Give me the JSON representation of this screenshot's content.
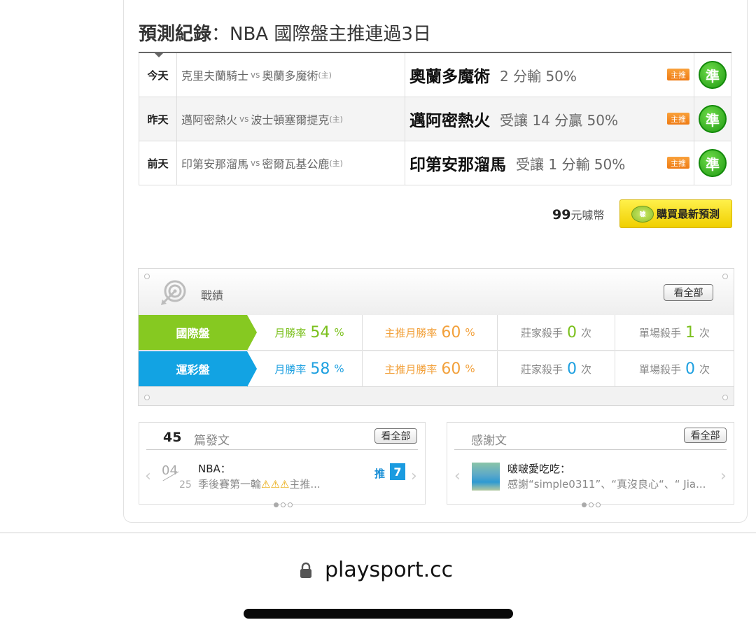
{
  "page_title": {
    "bold": "預測紀錄",
    "rest": "：NBA 國際盤主推連過3日"
  },
  "predictions": [
    {
      "day": "今天",
      "away": "克里夫蘭騎士",
      "vs": "vs",
      "home": "奧蘭多魔術",
      "home_mark": "(主)",
      "pick_team": "奧蘭多魔術",
      "pick_detail": "2 分輸 50%",
      "badge": "主推",
      "result": "準"
    },
    {
      "day": "昨天",
      "away": "邁阿密熱火",
      "vs": "vs",
      "home": "波士頓塞爾提克",
      "home_mark": "(主)",
      "pick_team": "邁阿密熱火",
      "pick_detail": "受讓 14 分贏 50%",
      "badge": "主推",
      "result": "準"
    },
    {
      "day": "前天",
      "away": "印第安那溜馬",
      "vs": "vs",
      "home": "密爾瓦基公鹿",
      "home_mark": "(主)",
      "pick_team": "印第安那溜馬",
      "pick_detail": "受讓 1 分輸 50%",
      "badge": "主推",
      "result": "準"
    }
  ],
  "purchase": {
    "price": "99",
    "price_unit": "元噱幣",
    "coin_label": "噱",
    "button_label": "購買最新預測"
  },
  "record": {
    "title": "戰績",
    "view_all": "看全部",
    "rows": [
      {
        "label": "國際盤",
        "color": "#86c921",
        "num_color": "#7bc01d",
        "month_label": "月勝率",
        "month_value": "54",
        "main_label": "主推月勝率",
        "main_value": "60",
        "pct": "%",
        "banker_label": "莊家殺手",
        "banker_value": "0",
        "single_label": "單場殺手",
        "single_value": "1",
        "times": "次"
      },
      {
        "label": "運彩盤",
        "color": "#12a3e3",
        "num_color": "#1ea0e0",
        "month_label": "月勝率",
        "month_value": "58",
        "main_label": "主推月勝率",
        "main_value": "60",
        "pct": "%",
        "banker_label": "莊家殺手",
        "banker_value": "0",
        "single_label": "單場殺手",
        "single_value": "0",
        "times": "次"
      }
    ],
    "main_color": "#f2a03a"
  },
  "posts": {
    "count": "45",
    "count_label": "篇發文",
    "view_all": "看全部",
    "month": "04",
    "day": "25",
    "title": "NBA：",
    "subtitle_prefix": "季後賽第一輪",
    "subtitle_warn": "⚠⚠⚠",
    "subtitle_suffix": "主推...",
    "push_label": "推",
    "push_count": "7"
  },
  "thanks": {
    "title": "感謝文",
    "view_all": "看全部",
    "user": "啵啵愛吃吃：",
    "message": "感謝“simple0311”、“真沒良心“、“ Jia..."
  },
  "browser": {
    "url": "playsport.cc"
  }
}
